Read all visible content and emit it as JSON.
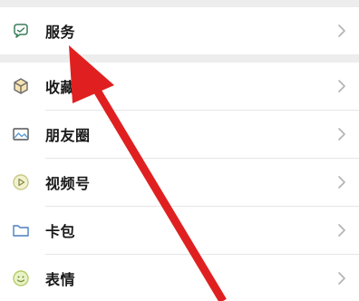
{
  "colors": {
    "background": "#ededed",
    "row_bg": "#ffffff",
    "text": "#191919",
    "icon_green": "#1aad19",
    "chevron": "#b2b2b2",
    "annotation_arrow": "#e02020"
  },
  "top_section": {
    "items": [
      {
        "label": "服务",
        "icon": "service-icon"
      }
    ]
  },
  "main_section": {
    "items": [
      {
        "label": "收藏",
        "icon": "favorites-icon"
      },
      {
        "label": "朋友圈",
        "icon": "moments-icon"
      },
      {
        "label": "视频号",
        "icon": "channels-icon"
      },
      {
        "label": "卡包",
        "icon": "card-wallet-icon"
      },
      {
        "label": "表情",
        "icon": "sticker-icon"
      }
    ]
  }
}
